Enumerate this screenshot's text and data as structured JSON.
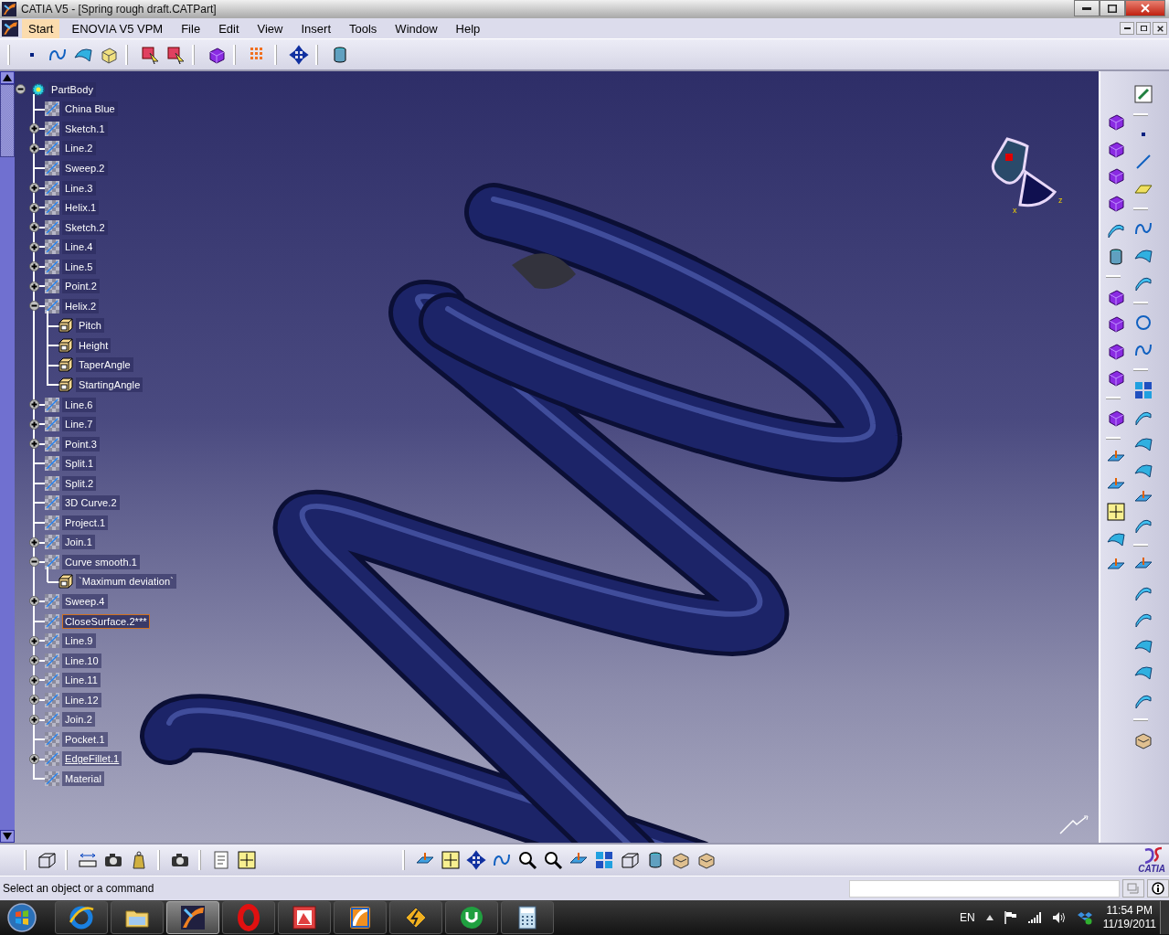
{
  "window": {
    "title": "CATIA V5 - [Spring rough draft.CATPart]"
  },
  "menu": [
    {
      "label": "Start",
      "selected": true
    },
    {
      "label": "ENOVIA V5 VPM",
      "selected": false
    },
    {
      "label": "File",
      "selected": false
    },
    {
      "label": "Edit",
      "selected": false
    },
    {
      "label": "View",
      "selected": false
    },
    {
      "label": "Insert",
      "selected": false
    },
    {
      "label": "Tools",
      "selected": false
    },
    {
      "label": "Window",
      "selected": false
    },
    {
      "label": "Help",
      "selected": false
    }
  ],
  "tree": {
    "root": {
      "label": "PartBody",
      "expanded": true,
      "selected": false,
      "current": false,
      "children": [
        {
          "label": "China Blue",
          "selected": false,
          "current": false
        },
        {
          "label": "Sketch.1",
          "expanded": false,
          "selected": false,
          "current": false
        },
        {
          "label": "Line.2",
          "expanded": false,
          "selected": false,
          "current": false
        },
        {
          "label": "Sweep.2",
          "selected": false,
          "current": false
        },
        {
          "label": "Line.3",
          "expanded": false,
          "selected": false,
          "current": false
        },
        {
          "label": "Helix.1",
          "expanded": false,
          "selected": false,
          "current": false
        },
        {
          "label": "Sketch.2",
          "expanded": false,
          "selected": false,
          "current": false
        },
        {
          "label": "Line.4",
          "expanded": false,
          "selected": false,
          "current": false
        },
        {
          "label": "Line.5",
          "expanded": false,
          "selected": false,
          "current": false
        },
        {
          "label": "Point.2",
          "expanded": false,
          "selected": false,
          "current": false
        },
        {
          "label": "Helix.2",
          "expanded": true,
          "selected": false,
          "current": false,
          "children": [
            {
              "label": "Pitch",
              "selected": false,
              "current": false
            },
            {
              "label": "Height",
              "selected": false,
              "current": false
            },
            {
              "label": "TaperAngle",
              "selected": false,
              "current": false
            },
            {
              "label": "StartingAngle",
              "selected": false,
              "current": false
            }
          ]
        },
        {
          "label": "Line.6",
          "expanded": false,
          "selected": false,
          "current": false
        },
        {
          "label": "Line.7",
          "expanded": false,
          "selected": false,
          "current": false
        },
        {
          "label": "Point.3",
          "expanded": false,
          "selected": false,
          "current": false
        },
        {
          "label": "Split.1",
          "selected": false,
          "current": false
        },
        {
          "label": "Split.2",
          "selected": false,
          "current": false
        },
        {
          "label": "3D Curve.2",
          "selected": false,
          "current": false
        },
        {
          "label": "Project.1",
          "selected": false,
          "current": false
        },
        {
          "label": "Join.1",
          "expanded": false,
          "selected": false,
          "current": false
        },
        {
          "label": "Curve smooth.1",
          "expanded": true,
          "selected": false,
          "current": false,
          "children": [
            {
              "label": "`Maximum deviation`",
              "selected": false,
              "current": false
            }
          ]
        },
        {
          "label": "Sweep.4",
          "expanded": false,
          "selected": false,
          "current": false
        },
        {
          "label": "CloseSurface.2***",
          "selected": true,
          "current": false
        },
        {
          "label": "Line.9",
          "expanded": false,
          "selected": false,
          "current": false
        },
        {
          "label": "Line.10",
          "expanded": false,
          "selected": false,
          "current": false
        },
        {
          "label": "Line.11",
          "expanded": false,
          "selected": false,
          "current": false
        },
        {
          "label": "Line.12",
          "expanded": false,
          "selected": false,
          "current": false
        },
        {
          "label": "Join.2",
          "expanded": false,
          "selected": false,
          "current": false
        },
        {
          "label": "Pocket.1",
          "selected": false,
          "current": false
        },
        {
          "label": "EdgeFillet.1",
          "expanded": false,
          "selected": false,
          "current": true
        },
        {
          "label": "Material",
          "selected": false,
          "current": false
        }
      ]
    }
  },
  "compass": {
    "x_label": "x",
    "z_label": "z"
  },
  "brand": {
    "label": "CATIA"
  },
  "status_bar": {
    "message": "Select an object or a command"
  },
  "taskbar": {
    "apps": [
      {
        "selected": false
      },
      {
        "selected": false
      },
      {
        "selected": true
      },
      {
        "selected": false
      },
      {
        "selected": false
      },
      {
        "selected": false
      },
      {
        "selected": false
      },
      {
        "selected": false
      },
      {
        "selected": false
      }
    ],
    "language": "EN",
    "time": "11:54 PM",
    "date": "11/19/2011"
  }
}
